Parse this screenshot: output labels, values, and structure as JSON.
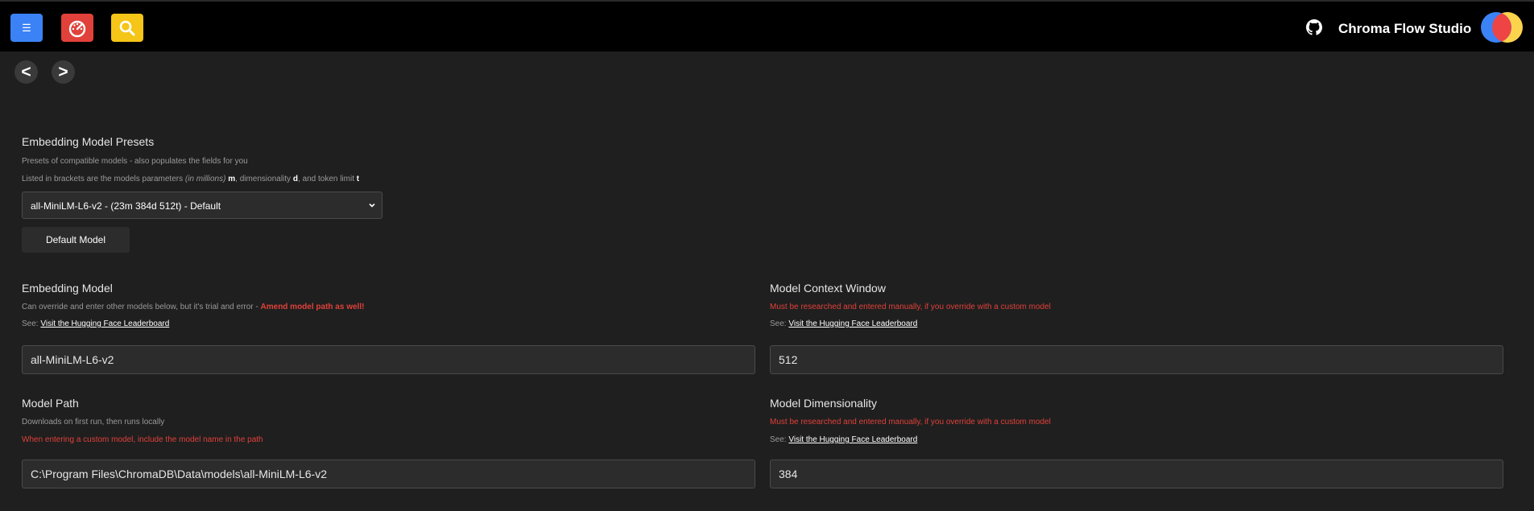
{
  "header": {
    "menu_icon": "☰",
    "app_title": "Chroma Flow Studio"
  },
  "nav": {
    "back": "<",
    "forward": ">"
  },
  "presets": {
    "title": "Embedding Model Presets",
    "help1": "Presets of compatible models - also populates the fields for you",
    "help2_a": "Listed in brackets are the models parameters ",
    "help2_italic": "(in millions)",
    "help2_m": "m",
    "help2_b": ", dimensionality ",
    "help2_d": "d",
    "help2_c": ", and token limit ",
    "help2_t": "t",
    "selected": "all-MiniLM-L6-v2 - (23m 384d 512t) - Default",
    "default_button": "Default Model"
  },
  "embedding_model": {
    "title": "Embedding Model",
    "help_a": "Can override and enter other models below, but it's trial and error - ",
    "help_warn": "Amend model path as well!",
    "see": "See: ",
    "link": "Visit the Hugging Face Leaderboard",
    "value": "all-MiniLM-L6-v2"
  },
  "context_window": {
    "title": "Model Context Window",
    "help": "Must be researched and entered manually, if you override with a custom model",
    "see": "See: ",
    "link": "Visit the Hugging Face Leaderboard",
    "value": "512"
  },
  "model_path": {
    "title": "Model Path",
    "help1": "Downloads on first run, then runs locally",
    "help2": "When entering a custom model, include the model name in the path",
    "value": "C:\\Program Files\\ChromaDB\\Data\\models\\all-MiniLM-L6-v2"
  },
  "dimensionality": {
    "title": "Model Dimensionality",
    "help": "Must be researched and entered manually, if you override with a custom model",
    "see": "See: ",
    "link": "Visit the Hugging Face Leaderboard",
    "value": "384"
  },
  "colors": {
    "menu_button": "#3b82f6",
    "dashboard_button": "#e0413a",
    "search_button": "#f5c518",
    "warning": "#e0413a"
  },
  "icons": {
    "menu": "menu-icon",
    "dashboard": "dashboard-gauge-icon",
    "search": "search-icon",
    "github": "github-icon",
    "logo": "chroma-logo"
  }
}
